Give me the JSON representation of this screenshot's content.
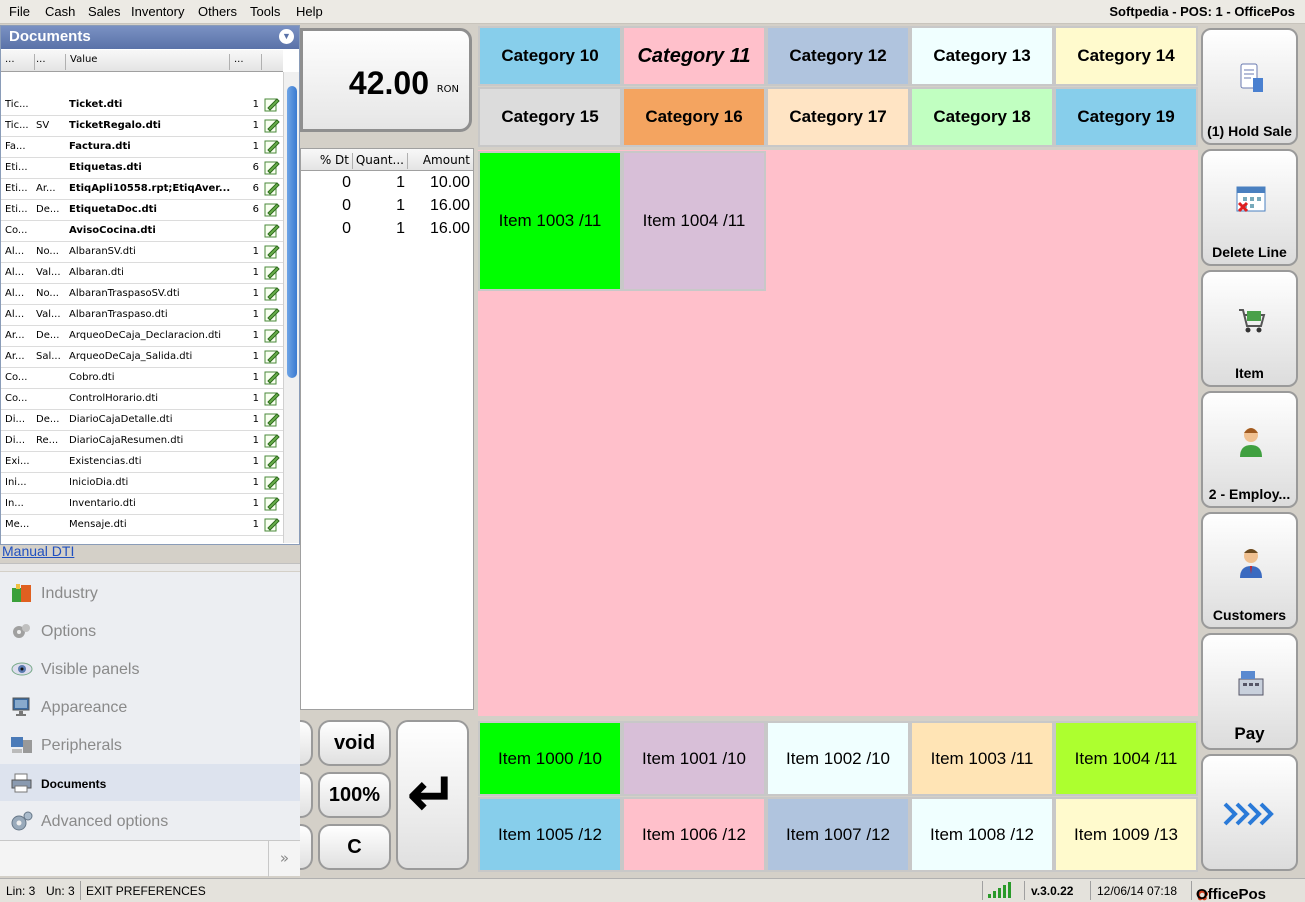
{
  "menu": {
    "items": [
      "File",
      "Cash",
      "Sales",
      "Inventory",
      "Others",
      "Tools",
      "Help"
    ],
    "title": "Softpedia - POS: 1 - OfficePos"
  },
  "documents_panel": {
    "title": "Documents",
    "columns": [
      "...",
      "...",
      "Value",
      "..."
    ],
    "rows": [
      {
        "a": "Tic...",
        "b": "",
        "value": "Ticket.dti",
        "n": "1",
        "bold": true
      },
      {
        "a": "Tic...",
        "b": "SV",
        "value": "TicketRegalo.dti",
        "n": "1",
        "bold": true
      },
      {
        "a": "Fa...",
        "b": "",
        "value": "Factura.dti",
        "n": "1",
        "bold": true
      },
      {
        "a": "Eti...",
        "b": "",
        "value": "Etiquetas.dti",
        "n": "6",
        "bold": true
      },
      {
        "a": "Eti...",
        "b": "Ar...",
        "value": "EtiqApli10558.rpt;EtiqAver...",
        "n": "6",
        "bold": true
      },
      {
        "a": "Eti...",
        "b": "De...",
        "value": "EtiquetaDoc.dti",
        "n": "6",
        "bold": true
      },
      {
        "a": "Co...",
        "b": "",
        "value": "AvisoCocina.dti",
        "n": "",
        "bold": true
      },
      {
        "a": "Al...",
        "b": "No...",
        "value": "AlbaranSV.dti",
        "n": "1",
        "bold": false
      },
      {
        "a": "Al...",
        "b": "Val...",
        "value": "Albaran.dti",
        "n": "1",
        "bold": false
      },
      {
        "a": "Al...",
        "b": "No...",
        "value": "AlbaranTraspasoSV.dti",
        "n": "1",
        "bold": false
      },
      {
        "a": "Al...",
        "b": "Val...",
        "value": "AlbaranTraspaso.dti",
        "n": "1",
        "bold": false
      },
      {
        "a": "Ar...",
        "b": "De...",
        "value": "ArqueoDeCaja_Declaracion.dti",
        "n": "1",
        "bold": false
      },
      {
        "a": "Ar...",
        "b": "Sal...",
        "value": "ArqueoDeCaja_Salida.dti",
        "n": "1",
        "bold": false
      },
      {
        "a": "Co...",
        "b": "",
        "value": "Cobro.dti",
        "n": "1",
        "bold": false
      },
      {
        "a": "Co...",
        "b": "",
        "value": "ControlHorario.dti",
        "n": "1",
        "bold": false
      },
      {
        "a": "Di...",
        "b": "De...",
        "value": "DiarioCajaDetalle.dti",
        "n": "1",
        "bold": false
      },
      {
        "a": "Di...",
        "b": "Re...",
        "value": "DiarioCajaResumen.dti",
        "n": "1",
        "bold": false
      },
      {
        "a": "Exi...",
        "b": "",
        "value": "Existencias.dti",
        "n": "1",
        "bold": false
      },
      {
        "a": "Ini...",
        "b": "",
        "value": "InicioDia.dti",
        "n": "1",
        "bold": false
      },
      {
        "a": "In...",
        "b": "",
        "value": "Inventario.dti",
        "n": "1",
        "bold": false
      },
      {
        "a": "Me...",
        "b": "",
        "value": "Mensaje.dti",
        "n": "1",
        "bold": false
      }
    ],
    "manual_link": "Manual DTI"
  },
  "nav": {
    "items": [
      {
        "label": "Industry",
        "icon": "industry-icon",
        "active": false
      },
      {
        "label": "Options",
        "icon": "options-icon",
        "active": false
      },
      {
        "label": "Visible panels",
        "icon": "eye-icon",
        "active": false
      },
      {
        "label": "Appareance",
        "icon": "monitor-icon",
        "active": false
      },
      {
        "label": "Peripherals",
        "icon": "peripherals-icon",
        "active": false
      },
      {
        "label": "Documents",
        "icon": "printer-icon",
        "active": true
      },
      {
        "label": "Advanced options",
        "icon": "gears-icon",
        "active": false
      }
    ],
    "more": "»"
  },
  "total": {
    "value": "42.00",
    "currency": "RON"
  },
  "lines": {
    "columns": [
      "% Dt",
      "Quant...",
      "Amount"
    ],
    "rows": [
      {
        "dt": "0",
        "qty": "1",
        "amount": "10.00"
      },
      {
        "dt": "0",
        "qty": "1",
        "amount": "16.00"
      },
      {
        "dt": "0",
        "qty": "1",
        "amount": "16.00"
      }
    ]
  },
  "keypad": {
    "void": "void",
    "percent": "100%",
    "clear": "C",
    "enter": "↵"
  },
  "categories": [
    {
      "label": "Category 10",
      "color": "#87ceeb",
      "selected": false
    },
    {
      "label": "Category 11",
      "color": "#ffc0cb",
      "selected": true
    },
    {
      "label": "Category 12",
      "color": "#b0c4de",
      "selected": false
    },
    {
      "label": "Category 13",
      "color": "#f0ffff",
      "selected": false
    },
    {
      "label": "Category 14",
      "color": "#fffacd",
      "selected": false
    },
    {
      "label": "Category 15",
      "color": "#dcdcdc",
      "selected": false
    },
    {
      "label": "Category 16",
      "color": "#f4a460",
      "selected": false
    },
    {
      "label": "Category 17",
      "color": "#ffe4c4",
      "selected": false
    },
    {
      "label": "Category 18",
      "color": "#c1ffc1",
      "selected": false
    },
    {
      "label": "Category 19",
      "color": "#87ceeb",
      "selected": false
    }
  ],
  "items": [
    {
      "label": "Item 1003 /11",
      "color": "#00ff00"
    },
    {
      "label": "Item 1004 /11",
      "color": "#d8bfd8"
    }
  ],
  "bottom_items": [
    {
      "label": "Item 1000 /10",
      "color": "#00ff00"
    },
    {
      "label": "Item 1001 /10",
      "color": "#d8bfd8"
    },
    {
      "label": "Item 1002 /10",
      "color": "#f0ffff"
    },
    {
      "label": "Item 1003 /11",
      "color": "#ffe4b5"
    },
    {
      "label": "Item 1004 /11",
      "color": "#adff2f"
    },
    {
      "label": "Item 1005 /12",
      "color": "#87ceeb"
    },
    {
      "label": "Item 1006 /12",
      "color": "#ffc0cb"
    },
    {
      "label": "Item 1007 /12",
      "color": "#b0c4de"
    },
    {
      "label": "Item 1008 /12",
      "color": "#f0ffff"
    },
    {
      "label": "Item 1009 /13",
      "color": "#fffacd"
    }
  ],
  "actions": [
    {
      "label": "(1) Hold Sale",
      "icon": "hold-sale-icon"
    },
    {
      "label": "Delete Line",
      "icon": "delete-line-icon"
    },
    {
      "label": "Item",
      "icon": "cart-icon"
    },
    {
      "label": "2 - Employ...",
      "icon": "employee-icon"
    },
    {
      "label": "Customers",
      "icon": "customer-icon"
    },
    {
      "label": "Pay",
      "icon": "pay-icon"
    },
    {
      "label": "",
      "icon": "forward-arrows-icon"
    }
  ],
  "status": {
    "lin": "Lin: 3",
    "un": "Un: 3",
    "message": "EXIT PREFERENCES",
    "version": "v.3.0.22",
    "datetime": "12/06/14 07:18",
    "brand": "OfficePos"
  }
}
